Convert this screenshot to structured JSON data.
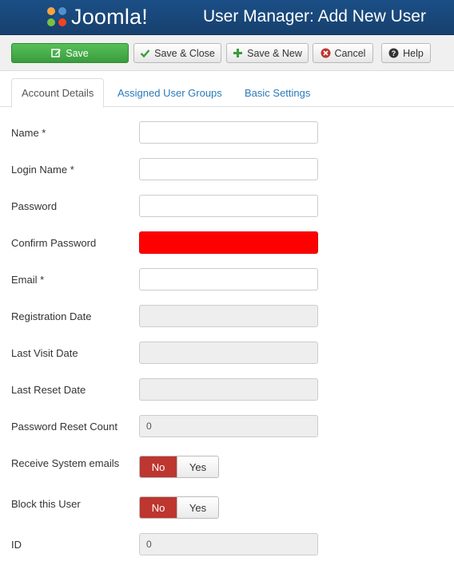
{
  "header": {
    "logo_text": "Joomla!",
    "title": "User Manager: Add New User"
  },
  "toolbar": {
    "save": "Save",
    "save_close": "Save & Close",
    "save_new": "Save & New",
    "cancel": "Cancel",
    "help": "Help"
  },
  "tabs": {
    "account": "Account Details",
    "groups": "Assigned User Groups",
    "basic": "Basic Settings"
  },
  "form": {
    "name": {
      "label": "Name *",
      "value": ""
    },
    "login": {
      "label": "Login Name *",
      "value": ""
    },
    "password": {
      "label": "Password",
      "value": ""
    },
    "confirm": {
      "label": "Confirm Password",
      "value": ""
    },
    "email": {
      "label": "Email *",
      "value": ""
    },
    "registration": {
      "label": "Registration Date",
      "value": ""
    },
    "last_visit": {
      "label": "Last Visit Date",
      "value": ""
    },
    "last_reset": {
      "label": "Last Reset Date",
      "value": ""
    },
    "reset_count": {
      "label": "Password Reset Count",
      "value": "0"
    },
    "send_email": {
      "label": "Receive System emails",
      "no": "No",
      "yes": "Yes",
      "selected": "No"
    },
    "block": {
      "label": "Block this User",
      "no": "No",
      "yes": "Yes",
      "selected": "No"
    },
    "id": {
      "label": "ID",
      "value": "0"
    }
  },
  "colors": {
    "header_bg": "#1b4f86",
    "save_green": "#3a9c3c",
    "no_active": "#bd362f",
    "error_field": "#ff0000",
    "link": "#2a7ab8"
  }
}
